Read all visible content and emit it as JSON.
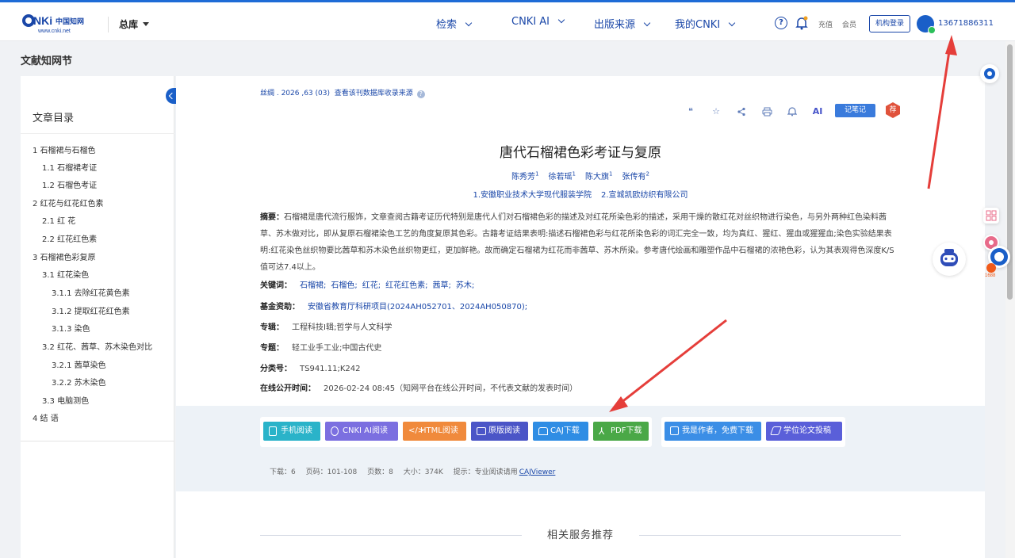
{
  "header": {
    "logo_text": "CNKi中国知网",
    "logo_url": "www.cnki.net",
    "library": "总库",
    "nav": [
      "检索",
      "CNKI AI",
      "出版来源",
      "我的CNKI"
    ],
    "recharge": "充值",
    "member": "会员",
    "org_login": "机构登录",
    "username": "13671886311"
  },
  "breadcrumb": "文献知网节",
  "toc": {
    "title": "文章目录",
    "items": [
      {
        "label": "1 石榴裙与石榴色",
        "level": 0
      },
      {
        "label": "1.1 石榴裙考证",
        "level": 1
      },
      {
        "label": "1.2 石榴色考证",
        "level": 1
      },
      {
        "label": "2 红花与红花红色素",
        "level": 0
      },
      {
        "label": "2.1 红 花",
        "level": 1
      },
      {
        "label": "2.2 红花红色素",
        "level": 1
      },
      {
        "label": "3 石榴裙色彩复原",
        "level": 0
      },
      {
        "label": "3.1 红花染色",
        "level": 1
      },
      {
        "label": "3.1.1 去除红花黄色素",
        "level": 2
      },
      {
        "label": "3.1.2 提取红花红色素",
        "level": 2
      },
      {
        "label": "3.1.3 染色",
        "level": 2
      },
      {
        "label": "3.2 红花、茜草、苏木染色对比",
        "level": 1
      },
      {
        "label": "3.2.1 茜草染色",
        "level": 2
      },
      {
        "label": "3.2.2 苏木染色",
        "level": 2
      },
      {
        "label": "3.3 电脑测色",
        "level": 1
      },
      {
        "label": "4 结 语",
        "level": 0
      }
    ]
  },
  "article": {
    "journal_line": "丝绸 . 2026 ,63 (03)",
    "journal_source_link": "查看该刊数据库收录来源",
    "note_button": "记笔记",
    "rec_badge": "荐",
    "ai_label": "AI",
    "title": "唐代石榴裙色彩考证与复原",
    "authors": [
      {
        "name": "陈秀芳",
        "sup": "1"
      },
      {
        "name": "徐若瑶",
        "sup": "1"
      },
      {
        "name": "陈大旗",
        "sup": "1"
      },
      {
        "name": "张传有",
        "sup": "2"
      }
    ],
    "affiliations": [
      "1.安徽职业技术大学现代服装学院",
      "2.宣城凯欧纺织有限公司"
    ],
    "abstract_label": "摘要：",
    "abstract": "石榴裙是唐代流行服饰，文章查阅古籍考证历代特别是唐代人们对石榴裙色彩的描述及对红花所染色彩的描述，采用干燥的散红花对丝织物进行染色，与另外两种红色染料茜草、苏木做对比，即从复原石榴裙染色工艺的角度复原其色彩。古籍考证结果表明:描述石榴裙色彩与红花所染色彩的词汇完全一致，均为真红、猩红、猩血或猩猩血;染色实验结果表明:红花染色丝织物要比茜草和苏木染色丝织物更红，更加鲜艳。故而确定石榴裙为红花而非茜草、苏木所染。参考唐代绘画和雕塑作品中石榴裙的浓艳色彩，认为其表观得色深度K/S值可达7.4以上。",
    "keywords_label": "关键词：",
    "keywords": [
      "石榴裙;",
      "石榴色;",
      "红花;",
      "红花红色素;",
      "茜草;",
      "苏木;"
    ],
    "fund_label": "基金资助：",
    "fund": "安徽省教育厅科研项目(2024AH052701、2024AH050870);",
    "series_label": "专辑：",
    "series": "工程科技Ⅰ辑;哲学与人文科学",
    "topic_label": "专题：",
    "topic": "轻工业手工业;中国古代史",
    "class_label": "分类号：",
    "class": "TS941.11;K242",
    "pubtime_label": "在线公开时间：",
    "pubtime": "2026-02-24 08:45（知网平台在线公开时间，不代表文献的发表时间）"
  },
  "download": {
    "buttons": [
      "手机阅读",
      "CNKI AI阅读",
      "HTML阅读",
      "原版阅读",
      "CAJ下载",
      "PDF下载"
    ],
    "extra_buttons": [
      "我是作者，免费下载",
      "学位论文投稿"
    ],
    "colors": [
      "#2ab3c9",
      "#7b6fe0",
      "#f08a3c",
      "#4b55c7",
      "#2f8de4",
      "#4aa847",
      "#3b8ee6",
      "#5a5fd9"
    ],
    "info": {
      "downloads": "下载：6",
      "pages_range": "页码：101-108",
      "pages": "页数：8",
      "size": "大小：374K",
      "tip": "提示：专业阅读请用",
      "viewer": "CAJViewer"
    }
  },
  "related_title": "相关服务推荐"
}
